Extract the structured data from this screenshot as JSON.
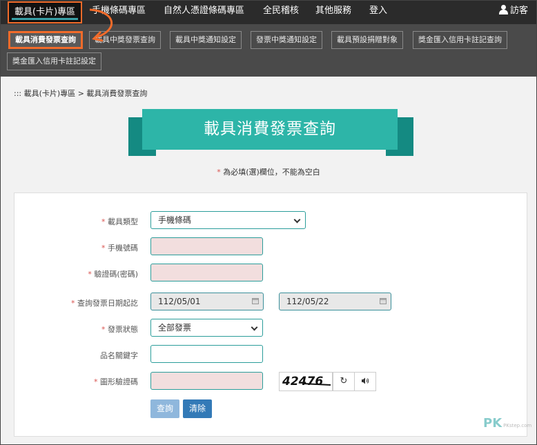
{
  "topnav": {
    "items": [
      "載具(卡片)專區",
      "手機條碼專區",
      "自然人憑證條碼專區",
      "全民稽核",
      "其他服務",
      "登入"
    ],
    "guest_label": "訪客"
  },
  "subnav": {
    "items": [
      "載具消費發票查詢",
      "載具中獎發票查詢",
      "載具中獎通知設定",
      "發票中獎通知設定",
      "載具預設捐贈對象",
      "獎金匯入信用卡註記查詢",
      "獎金匯入信用卡註記設定"
    ]
  },
  "breadcrumb": "::: 載具(卡片)專區 > 載具消費發票查詢",
  "title": "載具消費發票查詢",
  "required_note": {
    "star": "*",
    "text": "為必填(選)欄位，不能為空白"
  },
  "form": {
    "carrier_type": {
      "label": "載具類型",
      "value": "手機條碼"
    },
    "phone_barcode": {
      "label": "手機號碼",
      "value": ""
    },
    "verify_code": {
      "label": "驗證碼(密碼)",
      "value": ""
    },
    "date_range": {
      "label": "查詢發票日期起訖",
      "start": "112/05/01",
      "end": "112/05/22"
    },
    "invoice_status": {
      "label": "發票狀態",
      "value": "全部發票"
    },
    "keyword": {
      "label": "品名關鍵字",
      "value": ""
    },
    "captcha": {
      "label": "圖形驗證碼",
      "image_text": "42476",
      "value": ""
    },
    "query_button": "查詢",
    "clear_button": "清除"
  },
  "watermark": {
    "text": "PK",
    "sub": "PKstep.com"
  },
  "colors": {
    "accent": "#2db5a8",
    "highlight": "#f26b2a",
    "primary_btn": "#337ab7"
  }
}
